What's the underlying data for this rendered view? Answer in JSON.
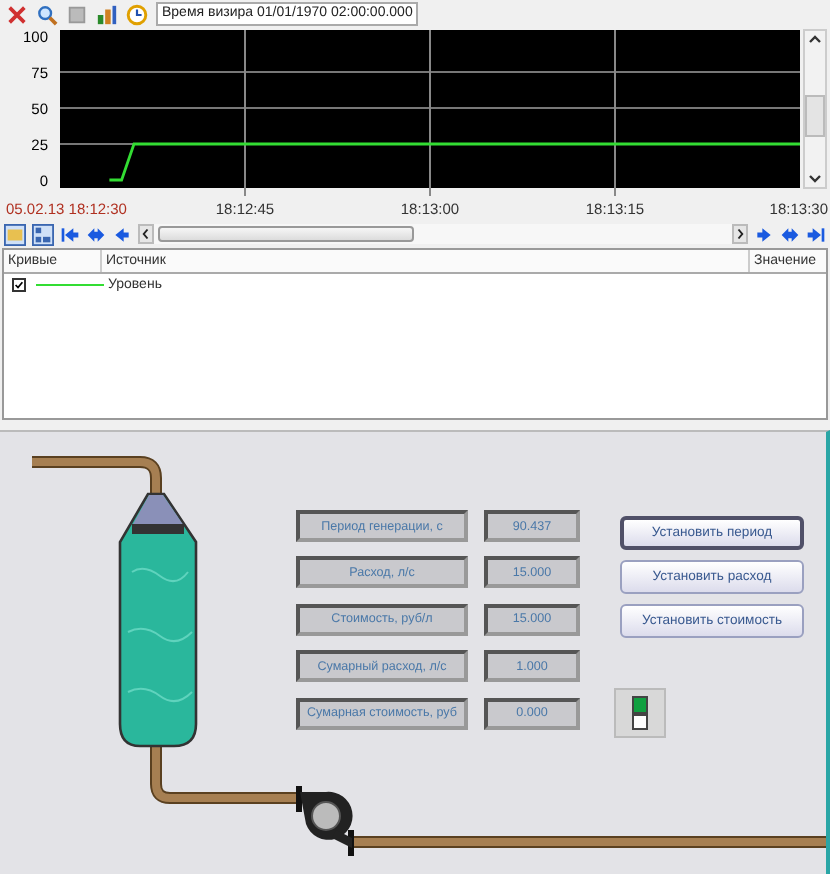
{
  "toolbar": {
    "cursor_time": "Время визира 01/01/1970 02:00:00.000"
  },
  "chart": {
    "chart_data": {
      "type": "line",
      "categories": [
        "05.02.13 18:12:30",
        null,
        null,
        null,
        null,
        null,
        null,
        null,
        null,
        null,
        null,
        null,
        null,
        null,
        null,
        "18:12:45",
        null,
        null,
        null,
        null,
        null,
        null,
        null,
        null,
        null,
        null,
        null,
        null,
        null,
        null,
        "18:13:00",
        null,
        null,
        null,
        null,
        null,
        null,
        null,
        null,
        null,
        null,
        null,
        null,
        null,
        null,
        "18:13:15",
        null,
        null,
        null,
        null,
        null,
        null,
        null,
        null,
        null,
        null,
        null,
        null,
        null,
        null,
        "18:13:30"
      ],
      "series": [
        {
          "color": "#33dd33",
          "values": [
            null,
            null,
            null,
            null,
            0,
            0,
            25,
            25,
            25,
            25,
            25,
            25,
            25,
            25,
            25,
            25,
            25,
            25,
            25,
            25,
            25,
            25,
            25,
            25,
            25,
            25,
            25,
            25,
            25,
            25,
            25,
            25,
            25,
            25,
            25,
            25,
            25,
            25,
            25,
            25,
            25,
            25,
            25,
            25,
            25,
            25,
            25,
            25,
            25,
            25,
            25,
            25,
            25,
            25,
            25,
            25,
            25,
            25,
            25,
            25,
            25
          ]
        }
      ],
      "grid": true,
      "ylim": [
        -5.5,
        104.2
      ],
      "yticks": [
        0,
        25,
        50,
        75,
        100
      ]
    }
  },
  "legend": {
    "columns": [
      "Кривые",
      "Источник",
      "Значение"
    ],
    "rows": [
      {
        "checked": true,
        "color": "#33dd33",
        "source": "Уровень"
      }
    ]
  },
  "fields": [
    {
      "label": "Период генерации, с",
      "value": "90.437"
    },
    {
      "label": "Расход, л/с",
      "value": "15.000"
    },
    {
      "label": "Стоимость, руб/л",
      "value": "15.000"
    },
    {
      "label": "Сумарный расход, л/с",
      "value": "1.000"
    },
    {
      "label": "Сумарная стоимость, руб",
      "value": "0.000"
    }
  ],
  "buttons": [
    {
      "label": "Установить период",
      "selected": true
    },
    {
      "label": "Установить расход",
      "selected": false
    },
    {
      "label": "Установить стоимость",
      "selected": false
    }
  ],
  "pump_switch": {
    "on": true
  }
}
